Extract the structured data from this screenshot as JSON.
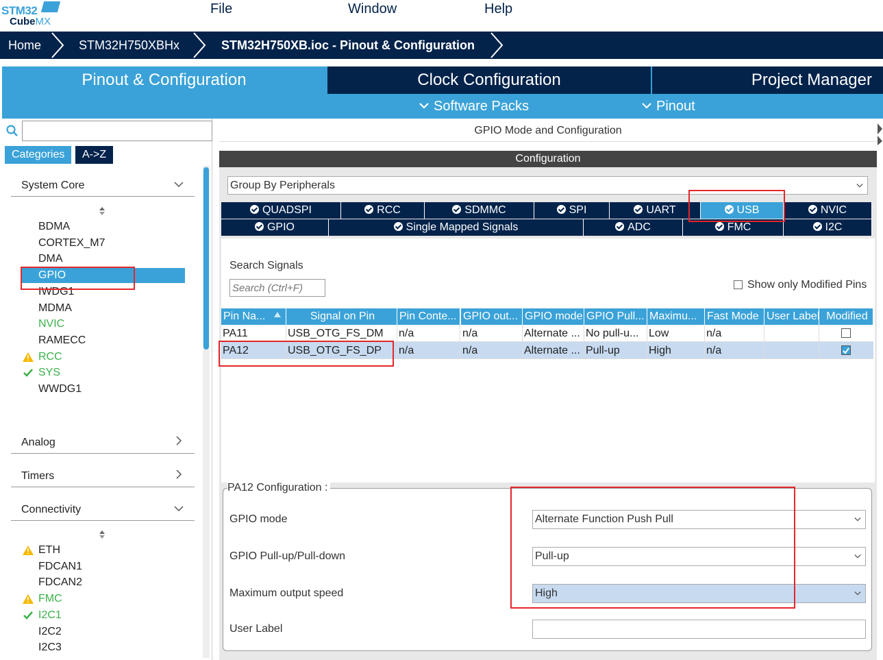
{
  "app": {
    "logo_line1": "STM32",
    "logo_line2a": "Cube",
    "logo_line2b": "MX"
  },
  "menu": [
    "File",
    "Window",
    "Help"
  ],
  "breadcrumb": [
    "Home",
    "STM32H750XBHx",
    "STM32H750XB.ioc - Pinout & Configuration"
  ],
  "tabs": [
    "Pinout & Configuration",
    "Clock Configuration",
    "Project Manager"
  ],
  "subtabs": [
    "Software Packs",
    "Pinout"
  ],
  "left": {
    "search_value": "",
    "cat_tabs": [
      "Categories",
      "A->Z"
    ],
    "system_core": {
      "label": "System Core",
      "items": [
        {
          "label": "BDMA",
          "status": ""
        },
        {
          "label": "CORTEX_M7",
          "status": ""
        },
        {
          "label": "DMA",
          "status": ""
        },
        {
          "label": "GPIO",
          "status": "selected"
        },
        {
          "label": "IWDG1",
          "status": ""
        },
        {
          "label": "MDMA",
          "status": ""
        },
        {
          "label": "NVIC",
          "status": "green"
        },
        {
          "label": "RAMECC",
          "status": ""
        },
        {
          "label": "RCC",
          "status": "warning"
        },
        {
          "label": "SYS",
          "status": "ok"
        },
        {
          "label": "WWDG1",
          "status": ""
        }
      ]
    },
    "analog": "Analog",
    "timers": "Timers",
    "connectivity": {
      "label": "Connectivity",
      "items": [
        {
          "label": "ETH",
          "status": "warning-plain"
        },
        {
          "label": "FDCAN1",
          "status": ""
        },
        {
          "label": "FDCAN2",
          "status": ""
        },
        {
          "label": "FMC",
          "status": "warning"
        },
        {
          "label": "I2C1",
          "status": "ok"
        },
        {
          "label": "I2C2",
          "status": ""
        },
        {
          "label": "I2C3",
          "status": ""
        }
      ]
    }
  },
  "right": {
    "title": "GPIO Mode and Configuration",
    "config_label": "Configuration",
    "group_by": "Group By Peripherals",
    "peripheral_tabs_row1": [
      "QUADSPI",
      "RCC",
      "SDMMC",
      "SPI",
      "UART",
      "USB",
      "NVIC"
    ],
    "peripheral_tabs_row2": [
      "GPIO",
      "Single Mapped Signals",
      "ADC",
      "FMC",
      "I2C"
    ],
    "selected_tab": "USB",
    "search_signals_label": "Search Signals",
    "search_placeholder": "Search (Ctrl+F)",
    "show_modified_label": "Show only Modified Pins",
    "table": {
      "headers": [
        "Pin Na...",
        "Signal on Pin",
        "Pin Conte...",
        "GPIO out...",
        "GPIO mode",
        "GPIO Pull...",
        "Maximu...",
        "Fast Mode",
        "User Label",
        "Modified"
      ],
      "rows": [
        {
          "cells": [
            "PA11",
            "USB_OTG_FS_DM",
            "n/a",
            "n/a",
            "Alternate ...",
            "No pull-u...",
            "Low",
            "n/a",
            ""
          ],
          "modified": false
        },
        {
          "cells": [
            "PA12",
            "USB_OTG_FS_DP",
            "n/a",
            "n/a",
            "Alternate ...",
            "Pull-up",
            "High",
            "n/a",
            ""
          ],
          "modified": true
        }
      ]
    },
    "pin_config": {
      "legend": "PA12 Configuration :",
      "fields": [
        {
          "label": "GPIO mode",
          "value": "Alternate Function Push Pull"
        },
        {
          "label": "GPIO Pull-up/Pull-down",
          "value": "Pull-up"
        },
        {
          "label": "Maximum output speed",
          "value": "High"
        },
        {
          "label": "User Label",
          "value": ""
        }
      ]
    }
  },
  "colors": {
    "navy": "#03234b",
    "blue": "#3aa2d8",
    "green": "#3bb14a",
    "warning": "#f5b800",
    "highlight": "#e4262b"
  }
}
